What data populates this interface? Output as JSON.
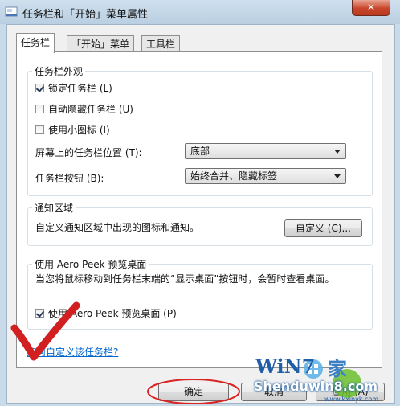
{
  "window": {
    "title": "任务栏和「开始」菜单属性",
    "close_glyph": "✕"
  },
  "tabs": [
    {
      "label": "任务栏"
    },
    {
      "label": "「开始」菜单"
    },
    {
      "label": "工具栏"
    }
  ],
  "appearance": {
    "legend": "任务栏外观",
    "checkboxes": [
      {
        "label": "锁定任务栏 (L)",
        "checked": true
      },
      {
        "label": "自动隐藏任务栏 (U)",
        "checked": false
      },
      {
        "label": "使用小图标 (I)",
        "checked": false
      }
    ],
    "position_label": "屏幕上的任务栏位置 (T):",
    "position_value": "底部",
    "buttons_label": "任务栏按钮 (B):",
    "buttons_value": "始终合并、隐藏标签"
  },
  "notification": {
    "legend": "通知区域",
    "text": "自定义通知区域中出现的图标和通知。",
    "customize_button": "自定义 (C)..."
  },
  "aero": {
    "legend": "使用 Aero Peek 预览桌面",
    "description": "当您将鼠标移动到任务栏末端的“显示桌面”按钮时，会暂时查看桌面。",
    "checkbox_label": "使用 Aero Peek 预览桌面 (P)",
    "checked": true
  },
  "help_link": "如何自定义该任务栏?",
  "footer": {
    "ok_button": "确定",
    "cancel_button": "取消",
    "apply_button": "应用 (A)"
  },
  "watermark": {
    "logo_text": "WiN7",
    "brand": "家",
    "site": "Shenduwin8.com",
    "url": "www.kxinyk.com"
  }
}
